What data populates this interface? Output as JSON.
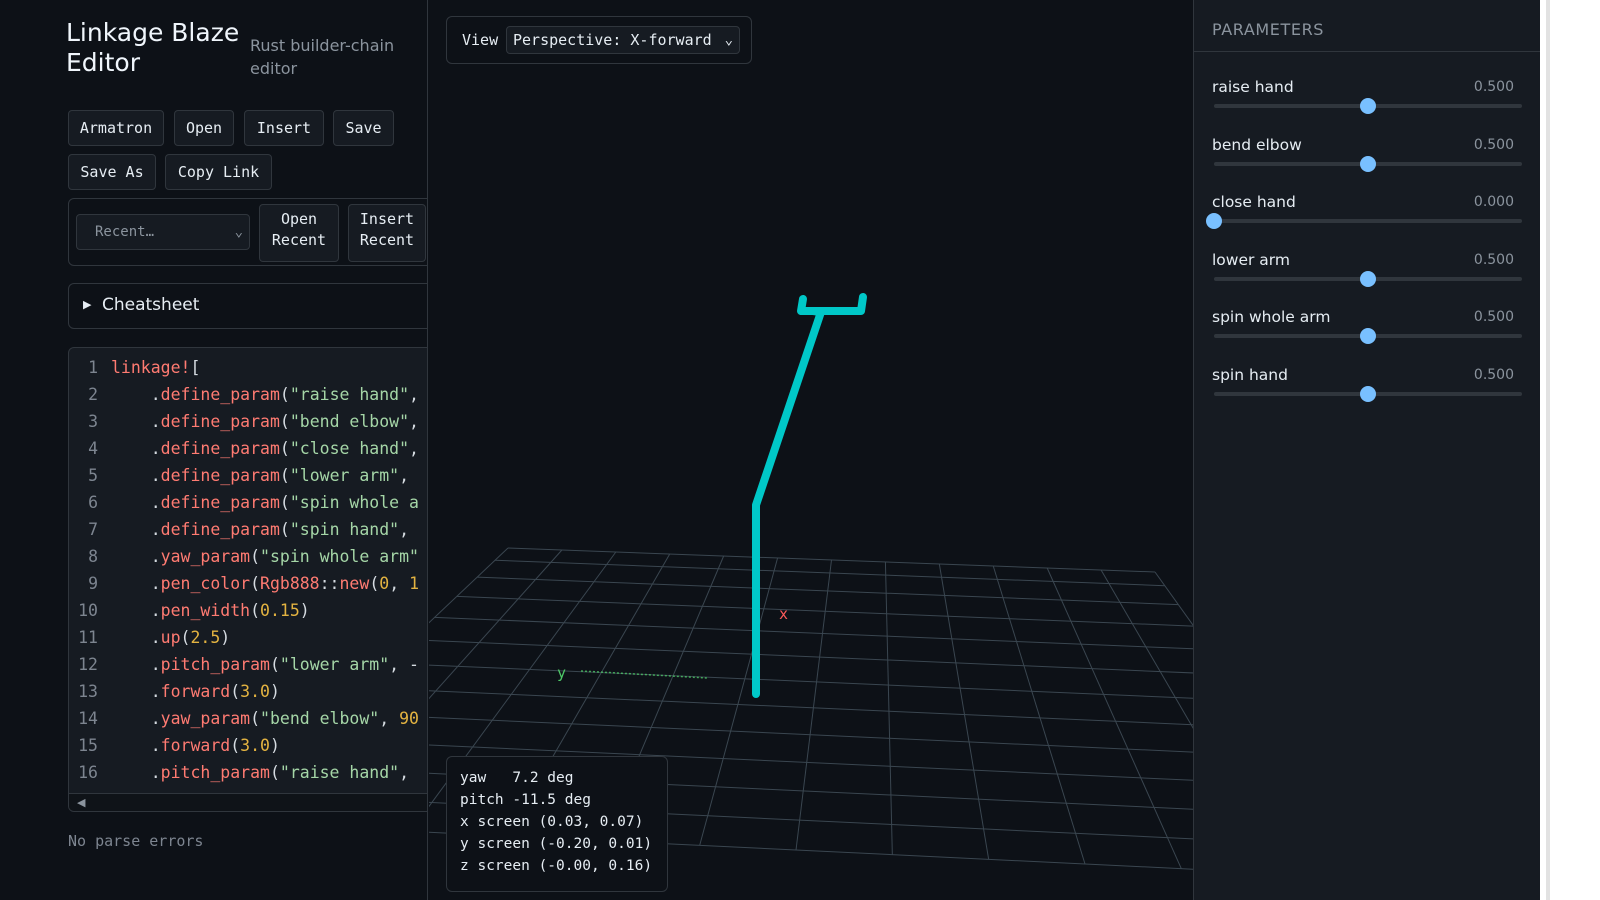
{
  "app": {
    "title": "Linkage Blaze Editor",
    "subtitle": "Rust builder-chain editor"
  },
  "toolbar": {
    "armatron": "Armatron",
    "open": "Open",
    "insert": "Insert",
    "save": "Save",
    "save_as": "Save As",
    "copy_link": "Copy Link"
  },
  "recent": {
    "placeholder": "Recent…",
    "open_line1": "Open",
    "open_line2": "Recent",
    "insert_line1": "Insert",
    "insert_line2": "Recent"
  },
  "cheatsheet": {
    "label": "Cheatsheet"
  },
  "code": {
    "lines": [
      {
        "n": "1",
        "tokens": [
          [
            "m",
            "linkage!"
          ],
          [
            "p",
            "["
          ]
        ]
      },
      {
        "n": "2",
        "tokens": [
          [
            "p",
            "    ."
          ],
          [
            "m",
            "define_param"
          ],
          [
            "p",
            "("
          ],
          [
            "s",
            "\"raise hand\""
          ],
          [
            "p",
            ","
          ]
        ]
      },
      {
        "n": "3",
        "tokens": [
          [
            "p",
            "    ."
          ],
          [
            "m",
            "define_param"
          ],
          [
            "p",
            "("
          ],
          [
            "s",
            "\"bend elbow\""
          ],
          [
            "p",
            ","
          ]
        ]
      },
      {
        "n": "4",
        "tokens": [
          [
            "p",
            "    ."
          ],
          [
            "m",
            "define_param"
          ],
          [
            "p",
            "("
          ],
          [
            "s",
            "\"close hand\""
          ],
          [
            "p",
            ","
          ]
        ]
      },
      {
        "n": "5",
        "tokens": [
          [
            "p",
            "    ."
          ],
          [
            "m",
            "define_param"
          ],
          [
            "p",
            "("
          ],
          [
            "s",
            "\"lower arm\""
          ],
          [
            "p",
            ","
          ]
        ]
      },
      {
        "n": "6",
        "tokens": [
          [
            "p",
            "    ."
          ],
          [
            "m",
            "define_param"
          ],
          [
            "p",
            "("
          ],
          [
            "s",
            "\"spin whole a"
          ]
        ]
      },
      {
        "n": "7",
        "tokens": [
          [
            "p",
            "    ."
          ],
          [
            "m",
            "define_param"
          ],
          [
            "p",
            "("
          ],
          [
            "s",
            "\"spin hand\""
          ],
          [
            "p",
            ","
          ]
        ]
      },
      {
        "n": "8",
        "tokens": [
          [
            "p",
            "    ."
          ],
          [
            "m",
            "yaw_param"
          ],
          [
            "p",
            "("
          ],
          [
            "s",
            "\"spin whole arm\""
          ]
        ]
      },
      {
        "n": "9",
        "tokens": [
          [
            "p",
            "    ."
          ],
          [
            "m",
            "pen_color"
          ],
          [
            "p",
            "("
          ],
          [
            "m",
            "Rgb888"
          ],
          [
            "p",
            "::"
          ],
          [
            "m",
            "new"
          ],
          [
            "p",
            "("
          ],
          [
            "n",
            "0"
          ],
          [
            "p",
            ", "
          ],
          [
            "n",
            "1"
          ]
        ]
      },
      {
        "n": "10",
        "tokens": [
          [
            "p",
            "    ."
          ],
          [
            "m",
            "pen_width"
          ],
          [
            "p",
            "("
          ],
          [
            "n",
            "0.15"
          ],
          [
            "p",
            ")"
          ]
        ]
      },
      {
        "n": "11",
        "tokens": [
          [
            "p",
            "    ."
          ],
          [
            "m",
            "up"
          ],
          [
            "p",
            "("
          ],
          [
            "n",
            "2.5"
          ],
          [
            "p",
            ")"
          ]
        ]
      },
      {
        "n": "12",
        "tokens": [
          [
            "p",
            "    ."
          ],
          [
            "m",
            "pitch_param"
          ],
          [
            "p",
            "("
          ],
          [
            "s",
            "\"lower arm\""
          ],
          [
            "p",
            ", -"
          ]
        ]
      },
      {
        "n": "13",
        "tokens": [
          [
            "p",
            "    ."
          ],
          [
            "m",
            "forward"
          ],
          [
            "p",
            "("
          ],
          [
            "n",
            "3.0"
          ],
          [
            "p",
            ")"
          ]
        ]
      },
      {
        "n": "14",
        "tokens": [
          [
            "p",
            "    ."
          ],
          [
            "m",
            "yaw_param"
          ],
          [
            "p",
            "("
          ],
          [
            "s",
            "\"bend elbow\""
          ],
          [
            "p",
            ", "
          ],
          [
            "n",
            "90"
          ]
        ]
      },
      {
        "n": "15",
        "tokens": [
          [
            "p",
            "    ."
          ],
          [
            "m",
            "forward"
          ],
          [
            "p",
            "("
          ],
          [
            "n",
            "3.0"
          ],
          [
            "p",
            ")"
          ]
        ]
      },
      {
        "n": "16",
        "tokens": [
          [
            "p",
            "    ."
          ],
          [
            "m",
            "pitch_param"
          ],
          [
            "p",
            "("
          ],
          [
            "s",
            "\"raise hand\""
          ],
          [
            "p",
            ","
          ]
        ]
      }
    ]
  },
  "status": {
    "parse": "No parse errors"
  },
  "viewport": {
    "view_label": "View",
    "view_value": "Perspective: X-forward",
    "axis_x_label": "x",
    "axis_y_label": "y",
    "axis_x_color": "#ff5a5a",
    "axis_y_color": "#4ec968",
    "linkage_color": "#00c8c8",
    "grid_color": "#3a4650",
    "readout": [
      "yaw   7.2 deg",
      "pitch -11.5 deg",
      "x screen (0.03, 0.07)",
      "y screen (-0.20, 0.01)",
      "z screen (-0.00, 0.16)"
    ]
  },
  "parameters": {
    "header": "PARAMETERS",
    "items": [
      {
        "label": "raise hand",
        "value": "0.500",
        "fraction": 0.5
      },
      {
        "label": "bend elbow",
        "value": "0.500",
        "fraction": 0.5
      },
      {
        "label": "close hand",
        "value": "0.000",
        "fraction": 0.0
      },
      {
        "label": "lower arm",
        "value": "0.500",
        "fraction": 0.5
      },
      {
        "label": "spin whole arm",
        "value": "0.500",
        "fraction": 0.5
      },
      {
        "label": "spin hand",
        "value": "0.500",
        "fraction": 0.5
      }
    ]
  },
  "colors": {
    "background": "#0d1117",
    "panel": "#161b22",
    "accent": "#79c0ff"
  }
}
